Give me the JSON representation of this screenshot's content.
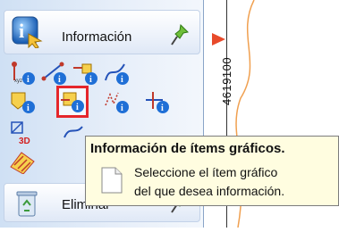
{
  "panel": {
    "section_title": "Información",
    "section_icon": "info-globe-icon",
    "pin_icon": "pin-icon",
    "tools": [
      {
        "name": "point-info-tool",
        "icon": "point-info-icon"
      },
      {
        "name": "line-info-tool",
        "icon": "line-info-icon"
      },
      {
        "name": "node-info-tool",
        "icon": "node-info-icon"
      },
      {
        "name": "curve-info-tool",
        "icon": "curve-info-icon"
      },
      {
        "name": "area-info-tool",
        "icon": "area-info-icon"
      },
      {
        "name": "graphic-item-info-tool",
        "icon": "graphic-item-info-icon",
        "selected": true
      },
      {
        "name": "path-info-tool",
        "icon": "path-info-icon"
      },
      {
        "name": "intersection-info-tool",
        "icon": "intersection-info-icon"
      },
      {
        "name": "3d-info-tool",
        "icon": "3d-info-icon",
        "label": "3D"
      },
      {
        "name": "profile-info-tool",
        "icon": "profile-info-icon"
      },
      {
        "name": "hatch-info-tool",
        "icon": "hatch-info-icon"
      }
    ],
    "bottom_section_title": "Eliminar",
    "bottom_section_icon": "recycle-bin-icon"
  },
  "map": {
    "coordinate_label": "4619100",
    "marker_icon": "red-arrow-icon",
    "colors": {
      "contour": "#f0a050",
      "marker": "#e84a2a"
    }
  },
  "tooltip": {
    "title": "Información de ítems gráficos.",
    "line1": "Seleccione el ítem gráfico",
    "line2": "del que desea información.",
    "icon": "document-icon",
    "background": "#fffde0"
  },
  "colors": {
    "selection_border": "#e5262b",
    "panel": "#dbe6f5"
  }
}
